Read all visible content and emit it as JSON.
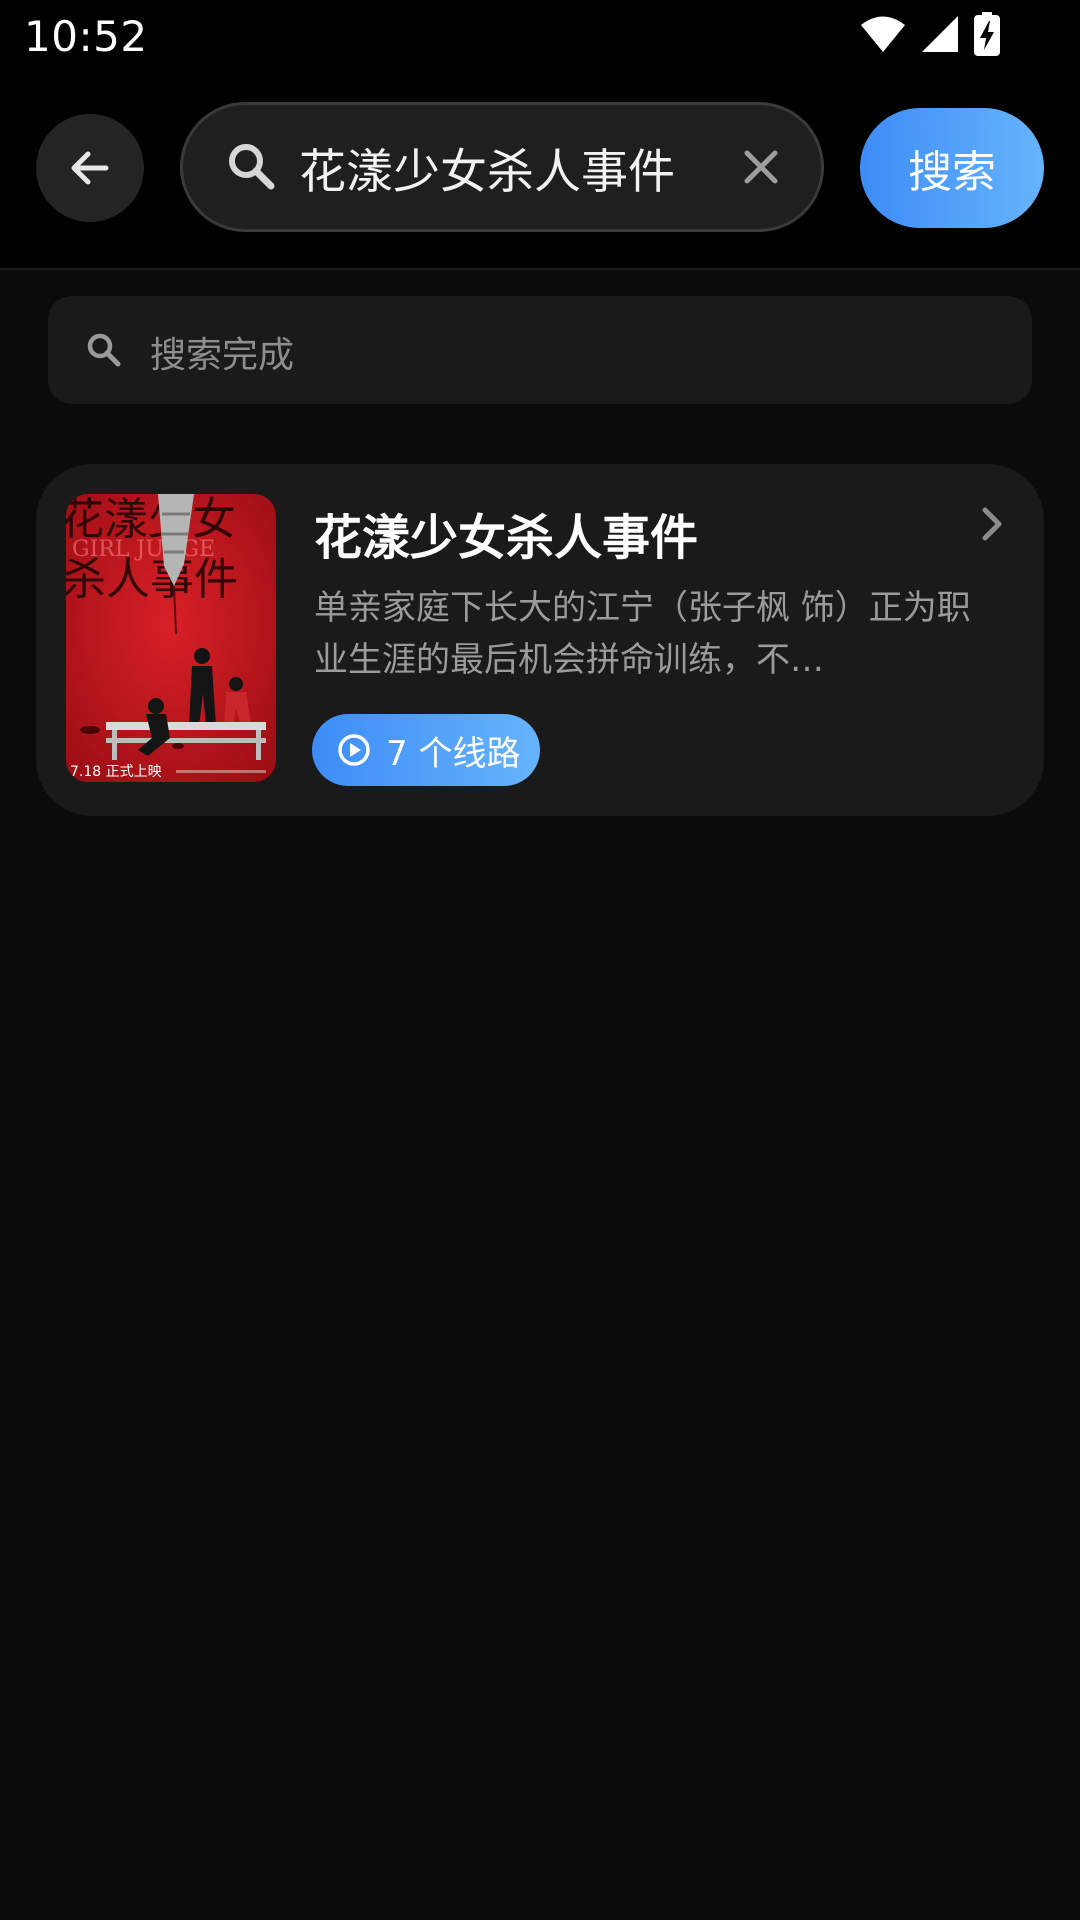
{
  "status_bar": {
    "time": "10:52",
    "icons": [
      "wifi-icon",
      "signal-icon",
      "battery-charging-icon"
    ]
  },
  "header": {
    "back_icon": "arrow-left-icon",
    "search": {
      "icon": "search-icon",
      "value": "花漾少女杀人事件",
      "clear_icon": "close-icon"
    },
    "search_button_label": "搜索"
  },
  "result_status": {
    "icon": "search-icon",
    "text": "搜索完成"
  },
  "results": [
    {
      "poster_text": {
        "title_line1": "花漾少女",
        "title_line2": "杀人事件",
        "english": "GIRL  JUDGE",
        "release": "7.18 正式上映"
      },
      "title": "花漾少女杀人事件",
      "description": "单亲家庭下长大的江宁（张子枫 饰）正为职业生涯的最后机会拼命训练，不…",
      "routes_label": "7 个线路",
      "routes_icon": "play-circle-icon",
      "chevron_icon": "chevron-right-icon"
    }
  ],
  "colors": {
    "background": "#0b0b0b",
    "card": "#1a1a1a",
    "accent_start": "#3d8cf7",
    "accent_end": "#66b4fb",
    "poster_red": "#c9161d"
  }
}
